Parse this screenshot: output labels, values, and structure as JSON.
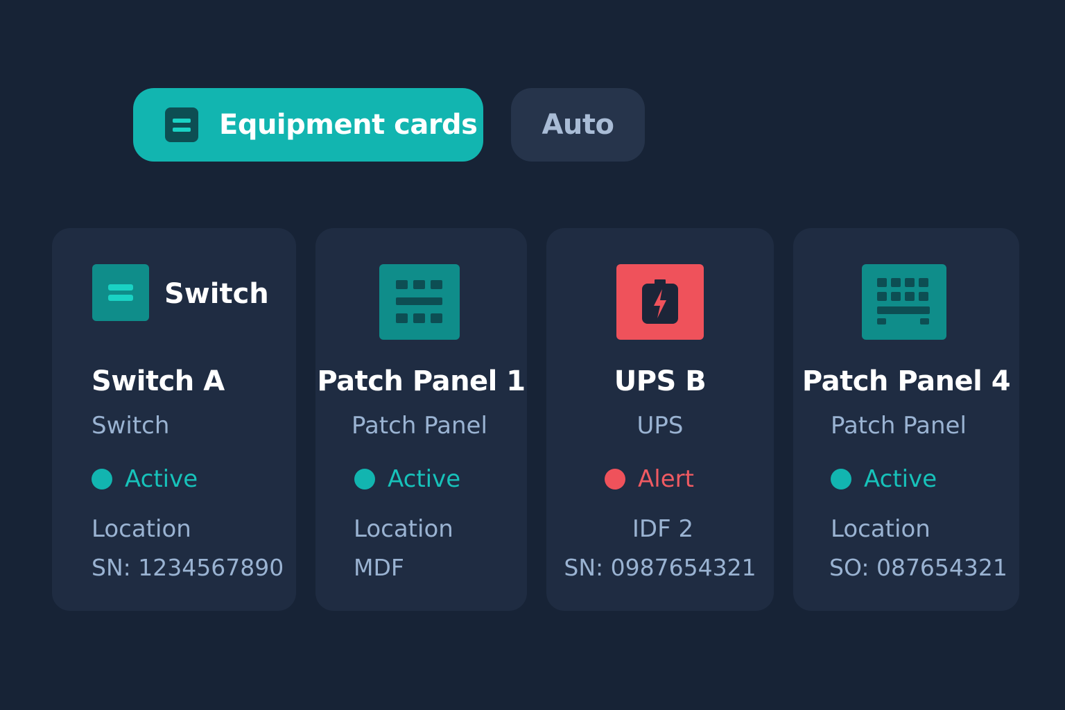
{
  "toolbar": {
    "equipment_cards_label": "Equipment cards",
    "auto_label": "Auto"
  },
  "colors": {
    "background": "#172336",
    "card": "#1f2c42",
    "accent": "#12b5b0",
    "alert": "#ef525b",
    "muted_text": "#9ab3d2"
  },
  "cards": [
    {
      "icon": "switch-icon",
      "type_heading": "Switch",
      "name": "Switch A",
      "type": "Switch",
      "status": "Active",
      "location": "Location",
      "serial": "SN: 1234567890"
    },
    {
      "icon": "patch-panel-icon",
      "name": "Patch Panel 1",
      "type": "Patch Panel",
      "status": "Active",
      "location": "Location",
      "serial": "MDF"
    },
    {
      "icon": "battery-bolt-icon",
      "name": "UPS B",
      "type": "UPS",
      "status": "Alert",
      "location": "IDF 2",
      "serial": "SN: 0987654321"
    },
    {
      "icon": "patch-panel-icon",
      "name": "Patch Panel 4",
      "type": "Patch Panel",
      "status": "Active",
      "location": "Location",
      "serial": "SO: 087654321"
    }
  ]
}
